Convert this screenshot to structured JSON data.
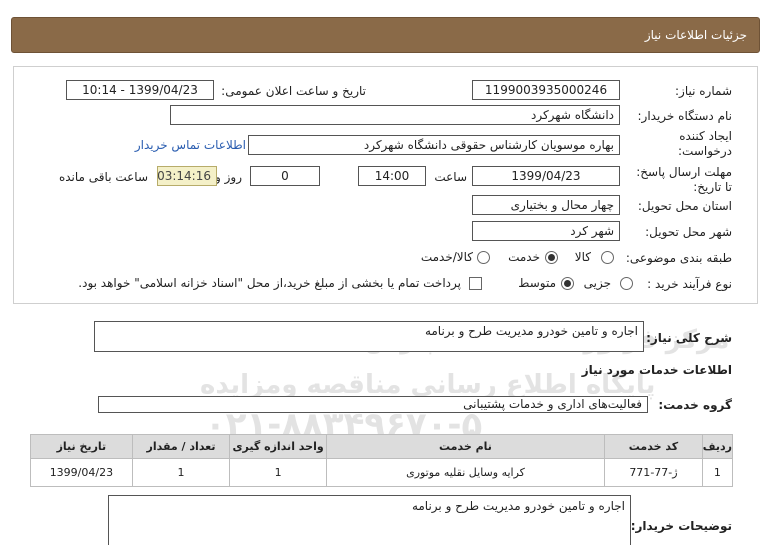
{
  "header": {
    "title": "جزئیات اطلاعات نیاز"
  },
  "form": {
    "need_number_label": "شماره نیاز:",
    "need_number": "1199003935000246",
    "announce_label": "تاریخ و ساعت اعلان عمومی:",
    "announce_value": "1399/04/23 - 10:14",
    "buyer_org_label": "نام دستگاه خریدار:",
    "buyer_org": "دانشگاه شهرکرد",
    "requester_label_1": "ایجاد کننده",
    "requester_label_2": "درخواست:",
    "requester": "بهاره موسویان کارشناس حقوقی دانشگاه شهرکرد",
    "contact_link": "اطلاعات تماس خریدار",
    "deadline_label_1": "مهلت ارسال پاسخ:",
    "deadline_label_2": "تا تاریخ:",
    "deadline_date": "1399/04/23",
    "time_label": "ساعت",
    "deadline_time": "14:00",
    "days_value": "0",
    "days_label": "روز و",
    "remaining_time": "03:14:16",
    "remaining_label": "ساعت باقی مانده",
    "province_label": "استان محل تحویل:",
    "province": "چهار محال و بختیاری",
    "city_label": "شهر محل تحویل:",
    "city": "شهر کرد",
    "category_label": "طبقه بندی موضوعی:",
    "category_options": [
      "کالا",
      "خدمت",
      "کالا/خدمت"
    ],
    "category_selected": "خدمت",
    "process_label": "نوع فرآیند خرید :",
    "process_options": [
      "جزیی",
      "متوسط"
    ],
    "process_selected": "متوسط",
    "payment_note": "پرداخت تمام یا بخشی از مبلغ خرید،از محل \"اسناد خزانه اسلامی\" خواهد بود."
  },
  "summary": {
    "label": "شرح کلی نیاز:",
    "value": "اجاره و تامین خودرو مدیریت طرح و برنامه"
  },
  "services_info": {
    "heading": "اطلاعات خدمات مورد نیاز",
    "group_label": "گروه خدمت:",
    "group_value": "فعالیت‌های اداری و خدمات پشتیبانی"
  },
  "table": {
    "headers": [
      "ردیف",
      "کد خدمت",
      "نام خدمت",
      "واحد اندازه گیری",
      "تعداد / مقدار",
      "تاریخ نیاز"
    ],
    "rows": [
      [
        "1",
        "ژ-77-771",
        "کرایه وسایل نقلیه موتوری",
        "1",
        "1",
        "1399/04/23"
      ]
    ]
  },
  "buyer_notes": {
    "label": "توضیحات خریدار:",
    "value": "اجاره و تامین خودرو مدیریت طرح و برنامه"
  },
  "watermark": {
    "line1": "ParsNamadData",
    "line2": "مرکز فراوری اطلاعات پارس نماد داده",
    "line3": "پایگاه اطلاع رسانی مناقصه ومزایده",
    "line4": "۰۲۱-۸۸۳۴۹۶۷۰-۵"
  }
}
